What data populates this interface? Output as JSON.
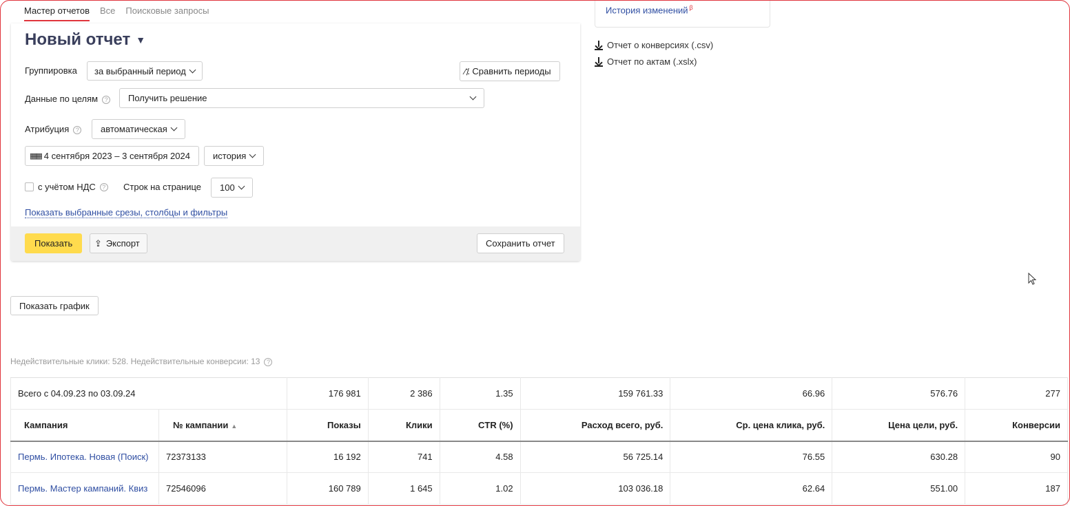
{
  "tabs": [
    {
      "label": "Мастер отчетов",
      "active": true
    },
    {
      "label": "Все",
      "active": false
    },
    {
      "label": "Поисковые запросы",
      "active": false
    }
  ],
  "report_title": "Новый отчет",
  "grouping": {
    "label": "Группировка",
    "value": "за выбранный период"
  },
  "compare_button": "Сравнить периоды",
  "goal_data": {
    "label": "Данные по целям",
    "value": "Получить решение"
  },
  "attribution": {
    "label": "Атрибуция",
    "value": "автоматическая"
  },
  "period": {
    "value": "4 сентября 2023 – 3 сентября 2024",
    "history": "история"
  },
  "vat": {
    "label": "с учётом НДС",
    "checked": false
  },
  "rows_per_page": {
    "label": "Строк на странице",
    "value": "100"
  },
  "show_filters_link": "Показать выбранные срезы, столбцы и фильтры",
  "footer": {
    "show": "Показать",
    "export": "Экспорт",
    "save": "Сохранить отчет"
  },
  "side": {
    "history_link": "История изменений",
    "beta": "β",
    "downloads": [
      "Отчет о конверсиях (.csv)",
      "Отчет по актам (.xslx)"
    ]
  },
  "show_chart_button": "Показать график",
  "invalid_note": "Недействительные клики: 528. Недействительные конверсии: 13",
  "table": {
    "total": {
      "label": "Всего с 04.09.23 по 03.09.24",
      "values": [
        "176 981",
        "2 386",
        "1.35",
        "159 761.33",
        "66.96",
        "576.76",
        "277"
      ]
    },
    "headers": [
      "Кампания",
      "№ кампании",
      "Показы",
      "Клики",
      "CTR (%)",
      "Расход всего, руб.",
      "Ср. цена клика, руб.",
      "Цена цели, руб.",
      "Конверсии"
    ],
    "rows": [
      {
        "campaign": "Пермь. Ипотека. Новая (Поиск)",
        "id": "72373133",
        "values": [
          "16 192",
          "741",
          "4.58",
          "56 725.14",
          "76.55",
          "630.28",
          "90"
        ]
      },
      {
        "campaign": "Пермь. Мастер кампаний. Квиз",
        "id": "72546096",
        "values": [
          "160 789",
          "1 645",
          "1.02",
          "103 036.18",
          "62.64",
          "551.00",
          "187"
        ]
      }
    ]
  },
  "colors": {
    "accent_red": "#e0343c",
    "link_blue": "#2f4ea2",
    "button_yellow": "#ffdb4d",
    "title": "#3a3f5c"
  }
}
